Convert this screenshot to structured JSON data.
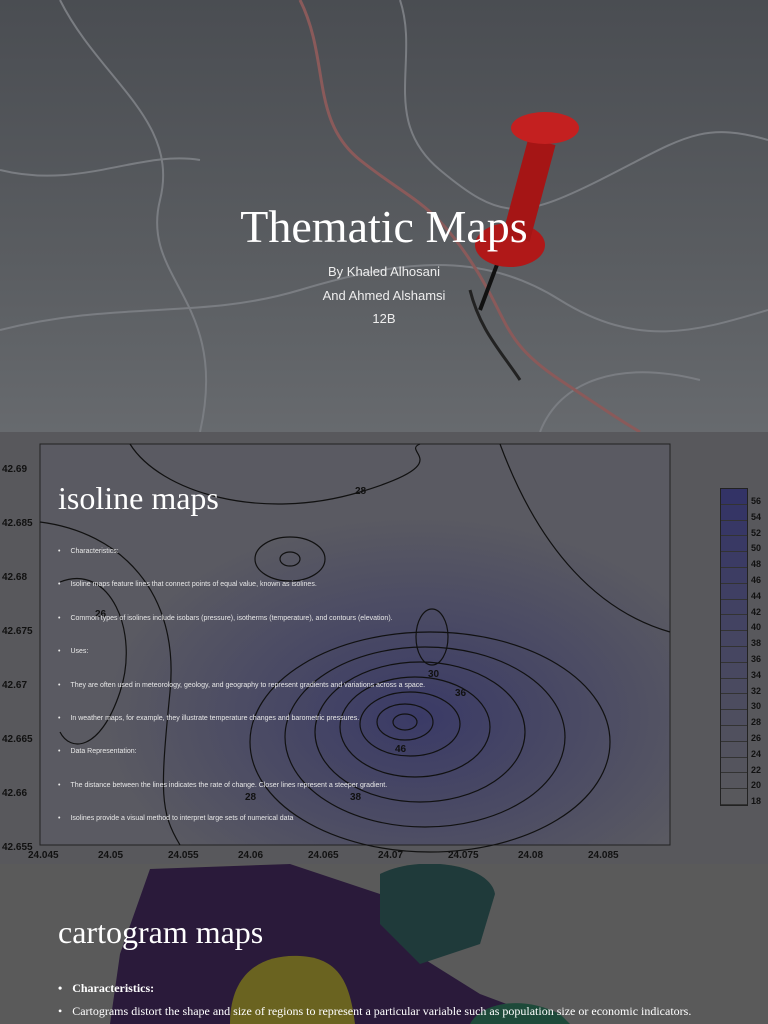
{
  "slide1": {
    "title": "Thematic Maps",
    "byline": "By Khaled Alhosani",
    "byline2": "And Ahmed Alshamsi",
    "class": "12B"
  },
  "slide2": {
    "title": "isoline maps",
    "bullets": [
      "Characteristics:",
      "Isoline maps feature lines that connect points of equal value, known as isolines.",
      "Common types of isolines include isobars (pressure), isotherms (temperature), and contours (elevation).",
      "Uses:",
      "They are often used in meteorology, geology, and geography to represent gradients and variations across a space.",
      "In weather maps, for example, they illustrate temperature changes and barometric pressures.",
      "Data Representation:",
      "The distance between the lines indicates the rate of change. Closer lines represent a steeper gradient.",
      "Isolines provide a visual method to interpret large sets of numerical data"
    ],
    "y_ticks": [
      "42.69",
      "42.685",
      "42.68",
      "42.675",
      "42.67",
      "42.665",
      "42.66",
      "42.655"
    ],
    "x_ticks": [
      "24.045",
      "24.05",
      "24.055",
      "24.06",
      "24.065",
      "24.07",
      "24.075",
      "24.08",
      "24.085"
    ],
    "legend": [
      "56",
      "54",
      "52",
      "50",
      "48",
      "46",
      "44",
      "42",
      "40",
      "38",
      "36",
      "34",
      "32",
      "30",
      "28",
      "26",
      "24",
      "22",
      "20",
      "18"
    ],
    "contour_labels": [
      "28",
      "30",
      "26",
      "36",
      "46",
      "38",
      "28"
    ]
  },
  "slide3": {
    "title": "cartogram maps",
    "bullets": [
      "Characteristics:",
      "Cartograms distort the shape and size of regions to represent a particular variable such as population size or economic indicators."
    ]
  }
}
